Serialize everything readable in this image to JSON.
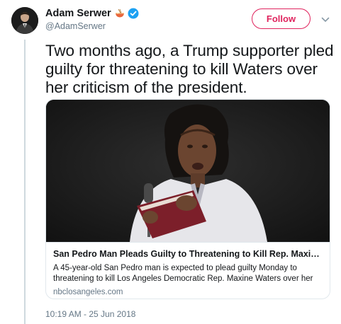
{
  "author": {
    "display_name": "Adam Serwer",
    "handle": "@AdamSerwer",
    "emoji_icon": "ramen-bowl-emoji",
    "verified": true
  },
  "actions": {
    "follow_label": "Follow"
  },
  "tweet": {
    "text": "Two months ago, a Trump supporter pled guilty for threatening to kill Waters over her criticism of the president.",
    "timestamp": "10:19 AM - 25 Jun 2018"
  },
  "card": {
    "title": "San Pedro Man Pleads Guilty to Threatening to Kill Rep. Maxine Wat...",
    "description": "A 45-year-old San Pedro man is expected to plead guilty Monday to threatening to kill Los Angeles Democratic Rep. Maxine Waters over her o...",
    "domain": "nbclosangeles.com"
  },
  "colors": {
    "accent": "#e0245e",
    "verified_blue": "#1da1f2",
    "secondary_text": "#657786"
  }
}
